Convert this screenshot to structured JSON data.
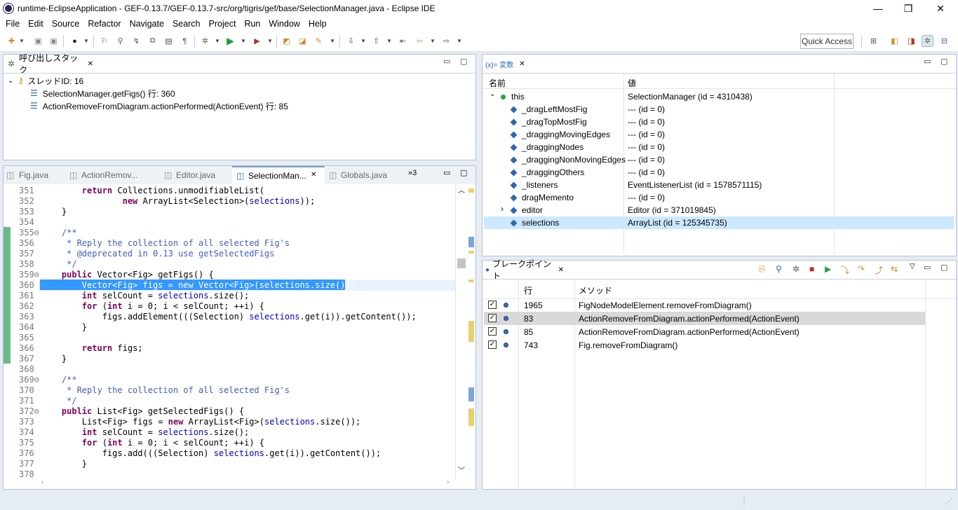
{
  "window": {
    "title": "runtime-EclipseApplication - GEF-0.13.7/GEF-0.13.7-src/org/tigris/gef/base/SelectionManager.java - Eclipse IDE"
  },
  "menu": [
    "File",
    "Edit",
    "Source",
    "Refactor",
    "Navigate",
    "Search",
    "Project",
    "Run",
    "Window",
    "Help"
  ],
  "toolbar": {
    "quick_access": "Quick Access"
  },
  "callstack": {
    "tab": "呼び出しスタック",
    "thread": "スレッドID: 16",
    "frames": [
      "SelectionManager.getFigs() 行: 360",
      "ActionRemoveFromDiagram.actionPerformed(ActionEvent) 行: 85"
    ]
  },
  "editor": {
    "tabs": [
      "Fig.java",
      "ActionRemov...",
      "Editor.java",
      "SelectionMan...",
      "Globals.java"
    ],
    "overflow": "»3",
    "lines": [
      {
        "n": "351",
        "t": "        return Collections.unmodifiableList("
      },
      {
        "n": "352",
        "t": "                new ArrayList<Selection>(selections));"
      },
      {
        "n": "353",
        "t": "    }"
      },
      {
        "n": "354",
        "t": ""
      },
      {
        "n": "355⊖",
        "t": "    /**"
      },
      {
        "n": "356",
        "t": "     * Reply the collection of all selected Fig's"
      },
      {
        "n": "357",
        "t": "     * @deprecated in 0.13 use getSelectedFigs"
      },
      {
        "n": "358",
        "t": "     */"
      },
      {
        "n": "359⊖",
        "t": "    public Vector<Fig> getFigs() {"
      },
      {
        "n": "360",
        "t": "        Vector<Fig> figs = new Vector<Fig>(selections.size());"
      },
      {
        "n": "361",
        "t": "        int selCount = selections.size();"
      },
      {
        "n": "362",
        "t": "        for (int i = 0; i < selCount; ++i) {"
      },
      {
        "n": "363",
        "t": "            figs.addElement(((Selection) selections.get(i)).getContent());"
      },
      {
        "n": "364",
        "t": "        }"
      },
      {
        "n": "365",
        "t": ""
      },
      {
        "n": "366",
        "t": "        return figs;"
      },
      {
        "n": "367",
        "t": "    }"
      },
      {
        "n": "368",
        "t": ""
      },
      {
        "n": "369⊖",
        "t": "    /**"
      },
      {
        "n": "370",
        "t": "     * Reply the collection of all selected Fig's"
      },
      {
        "n": "371",
        "t": "     */"
      },
      {
        "n": "372⊖",
        "t": "    public List<Fig> getSelectedFigs() {"
      },
      {
        "n": "373",
        "t": "        List<Fig> figs = new ArrayList<Fig>(selections.size());"
      },
      {
        "n": "374",
        "t": "        int selCount = selections.size();"
      },
      {
        "n": "375",
        "t": "        for (int i = 0; i < selCount; ++i) {"
      },
      {
        "n": "376",
        "t": "            figs.add(((Selection) selections.get(i)).getContent());"
      },
      {
        "n": "377",
        "t": "        }"
      },
      {
        "n": "378",
        "t": ""
      }
    ]
  },
  "variables": {
    "tab": "(x)= 変数",
    "headers": [
      "名前",
      "値"
    ],
    "rows": [
      {
        "name": "this",
        "value": "SelectionManager (id = 4310438)",
        "expanded": true
      },
      {
        "name": "_dragLeftMostFig",
        "value": "--- (id = 0)"
      },
      {
        "name": "_dragTopMostFig",
        "value": "--- (id = 0)"
      },
      {
        "name": "_draggingMovingEdges",
        "value": "--- (id = 0)"
      },
      {
        "name": "_draggingNodes",
        "value": "--- (id = 0)"
      },
      {
        "name": "_draggingNonMovingEdges",
        "value": "--- (id = 0)"
      },
      {
        "name": "_draggingOthers",
        "value": "--- (id = 0)"
      },
      {
        "name": "_listeners",
        "value": "EventListenerList (id = 1578571115)"
      },
      {
        "name": "dragMemento",
        "value": "--- (id = 0)"
      },
      {
        "name": "editor",
        "value": "Editor (id = 371019845)",
        "collapsed": true
      },
      {
        "name": "selections",
        "value": "ArrayList (id = 125345735)",
        "selected": true
      }
    ]
  },
  "breakpoints": {
    "tab": "ブレークポイント",
    "headers": [
      "行",
      "メソッド"
    ],
    "rows": [
      {
        "line": "1965",
        "method": "FigNodeModelElement.removeFromDiagram()"
      },
      {
        "line": "83",
        "method": "ActionRemoveFromDiagram.actionPerformed(ActionEvent)",
        "selected": true
      },
      {
        "line": "85",
        "method": "ActionRemoveFromDiagram.actionPerformed(ActionEvent)"
      },
      {
        "line": "743",
        "method": "Fig.removeFromDiagram()"
      }
    ]
  }
}
